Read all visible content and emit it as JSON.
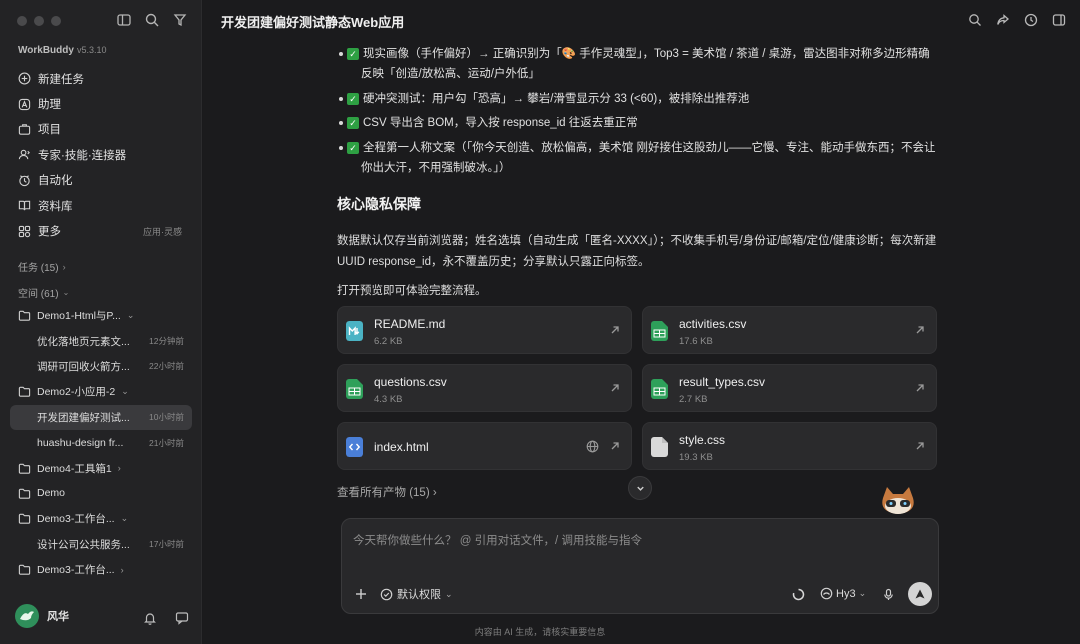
{
  "sidebar": {
    "brand": "WorkBuddy",
    "version": "v5.3.10",
    "nav": [
      {
        "label": "新建任务",
        "icon": "plus-circle-icon"
      },
      {
        "label": "助理",
        "icon": "assistant-icon"
      },
      {
        "label": "项目",
        "icon": "project-icon"
      },
      {
        "label": "专家·技能·连接器",
        "icon": "expert-icon"
      },
      {
        "label": "自动化",
        "icon": "automation-icon"
      },
      {
        "label": "资料库",
        "icon": "library-icon"
      },
      {
        "label": "更多",
        "icon": "more-icon",
        "aside": "应用·灵感"
      }
    ],
    "tasks_label": "任务 (15)",
    "spaces_label": "空间 (61)",
    "tree": [
      {
        "type": "folder",
        "label": "Demo1-Html与P..."
      },
      {
        "type": "sub",
        "label": "优化落地页元素文...",
        "time": "12分钟前"
      },
      {
        "type": "sub",
        "label": "调研可回收火箭方...",
        "time": "22小时前"
      },
      {
        "type": "folder",
        "label": "Demo2-小应用-2"
      },
      {
        "type": "sub",
        "label": "开发团建偏好测试...",
        "time": "10小时前",
        "active": true
      },
      {
        "type": "sub",
        "label": "huashu-design fr...",
        "time": "21小时前"
      },
      {
        "type": "folder",
        "label": "Demo4-工具箱1"
      },
      {
        "type": "folder",
        "label": "Demo"
      },
      {
        "type": "folder",
        "label": "Demo3-工作台..."
      },
      {
        "type": "sub",
        "label": "设计公司公共服务...",
        "time": "17小时前"
      },
      {
        "type": "folder",
        "label": "Demo3-工作台..."
      }
    ],
    "user_name": "风华"
  },
  "main": {
    "title": "开发团建偏好测试静态Web应用",
    "bullets": [
      "现实画像（手作偏好）→ 正确识别为「🎨 手作灵魂型」，Top3 = 美术馆 / 茶道 / 桌游，雷达图非对称多边形精确反映「创造/放松高、运动/户外低」",
      "硬冲突测试：用户勾「恐高」→ 攀岩/滑雪显示分 33 (<60)，被排除出推荐池",
      "CSV 导出含 BOM，导入按 response_id 往返去重正常",
      "全程第一人称文案（「你今天创造、放松偏高，美术馆 刚好接住这股劲儿——它慢、专注、能动手做东西；不会让你出大汗，不用强制破冰。」）"
    ],
    "section_title": "核心隐私保障",
    "privacy_text": "数据默认仅存当前浏览器；姓名选填（自动生成「匿名-XXXX」）；不收集手机号/身份证/邮箱/定位/健康诊断；每次新建 UUID response_id，永不覆盖历史；分享默认只露正向标签。",
    "preview_text": "打开预览即可体验完整流程。",
    "files": [
      {
        "name": "README.md",
        "size": "6.2 KB",
        "icon_color": "#4bb3c4",
        "icon": "markdown-file-icon"
      },
      {
        "name": "activities.csv",
        "size": "17.6 KB",
        "icon_color": "#2ea05a",
        "icon": "csv-file-icon"
      },
      {
        "name": "questions.csv",
        "size": "4.3 KB",
        "icon_color": "#2ea05a",
        "icon": "csv-file-icon"
      },
      {
        "name": "result_types.csv",
        "size": "2.7 KB",
        "icon_color": "#2ea05a",
        "icon": "csv-file-icon"
      },
      {
        "name": "index.html",
        "size": "",
        "icon_color": "#4a7fd8",
        "icon": "html-file-icon"
      },
      {
        "name": "style.css",
        "size": "19.3 KB",
        "icon_color": "#d9d9d9",
        "icon": "css-file-icon"
      }
    ],
    "view_all": "查看所有产物 (15) ›"
  },
  "composer": {
    "placeholder": "今天帮你做些什么？ @ 引用对话文件，/ 调用技能与指令",
    "permission": "默认权限",
    "model": "Hy3"
  },
  "footer": "内容由 AI 生成，请核实重要信息"
}
